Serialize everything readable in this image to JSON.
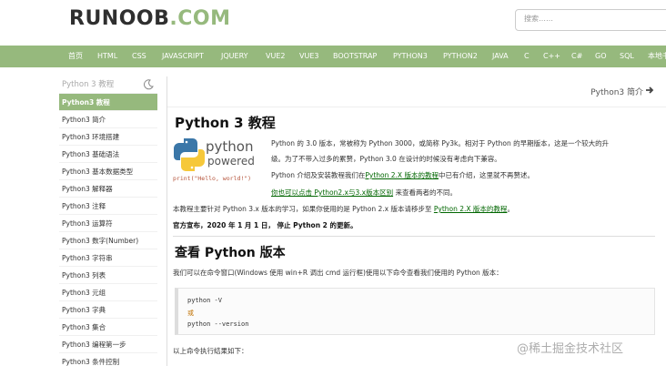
{
  "logo": {
    "main": "RUNOOB",
    "suffix": ".COM"
  },
  "search": {
    "placeholder": "搜索……"
  },
  "nav": [
    "首页",
    "HTML",
    "CSS",
    "JAVASCRIPT",
    "JQUERY",
    "VUE2",
    "VUE3",
    "BOOTSTRAP",
    "PYTHON3",
    "PYTHON2",
    "JAVA",
    "C",
    "C++",
    "C#",
    "GO",
    "SQL",
    "本地书签"
  ],
  "sidebar": {
    "heading": "Python 3 教程",
    "items": [
      "Python3 教程",
      "Python3 简介",
      "Python3 环境搭建",
      "Python3 基础语法",
      "Python3 基本数据类型",
      "Python3 解释器",
      "Python3 注释",
      "Python3 运算符",
      "Python3 数字(Number)",
      "Python3 字符串",
      "Python3 列表",
      "Python3 元组",
      "Python3 字典",
      "Python3 集合",
      "Python3 编程第一步",
      "Python3 条件控制"
    ]
  },
  "content": {
    "next_link": "Python3 简介",
    "title": "Python 3 教程",
    "python_logo": {
      "word1": "python",
      "word2": "powered",
      "code": "print(\"Hello, world!\")"
    },
    "intro_1": "Python 的 3.0 版本，常被称为 Python 3000，或简称 Py3k。相对于 Python 的早期版本，这是一个较大的升",
    "intro_2": "级。为了不带入过多的累赘，Python 3.0 在设计的时候没有考虑向下兼容。",
    "intro_3_pre": "Python 介绍及安装教程我们在",
    "intro_3_link": "Python 2.X 版本的教程",
    "intro_3_post": "中已有介绍，这里就不再赘述。",
    "intro_4_link": "你也可以点击 Python2.x与3.x版本区别",
    "intro_4_post": " 来查看两者的不同。",
    "intro_5_pre": "本教程主要针对 Python 3.x 版本的学习，如果你使用的是 Python 2.x 版本请移步至 ",
    "intro_5_link": "Python 2.X 版本的教程",
    "intro_5_post": "。",
    "notice": "官方宣布，2020 年 1 月 1 日， 停止 Python 2 的更新。",
    "h2": "查看 Python 版本",
    "check_text": "我们可以在命令窗口(Windows 使用 win+R 调出 cmd 运行框)使用以下命令查看我们使用的 Python 版本：",
    "code": [
      "python -V",
      "或",
      "python --version"
    ],
    "result_text": "以上命令执行结果如下："
  },
  "watermark": "@稀土掘金技术社区",
  "colors": {
    "brand_green": "#96b97d",
    "link_green": "#006600"
  }
}
